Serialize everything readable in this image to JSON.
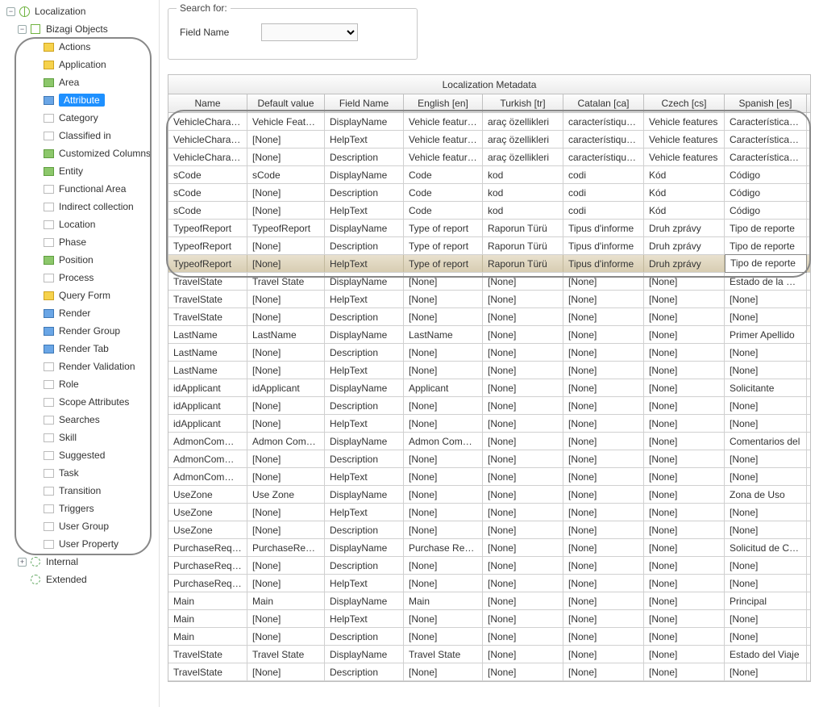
{
  "tree": {
    "root": "Localization",
    "bizagi": "Bizagi Objects",
    "internal": "Internal",
    "extended": "Extended",
    "items": [
      {
        "label": "Actions",
        "icon": "y"
      },
      {
        "label": "Application",
        "icon": "y"
      },
      {
        "label": "Area",
        "icon": "g"
      },
      {
        "label": "Attribute",
        "icon": "b",
        "selected": true
      },
      {
        "label": "Category",
        "icon": "o"
      },
      {
        "label": "Classified in",
        "icon": "o"
      },
      {
        "label": "Customized Columns",
        "icon": "g"
      },
      {
        "label": "Entity",
        "icon": "g"
      },
      {
        "label": "Functional Area",
        "icon": "o"
      },
      {
        "label": "Indirect collection",
        "icon": "o"
      },
      {
        "label": "Location",
        "icon": "o"
      },
      {
        "label": "Phase",
        "icon": "o"
      },
      {
        "label": "Position",
        "icon": "g"
      },
      {
        "label": "Process",
        "icon": "o"
      },
      {
        "label": "Query Form",
        "icon": "y"
      },
      {
        "label": "Render",
        "icon": "b"
      },
      {
        "label": "Render Group",
        "icon": "b"
      },
      {
        "label": "Render Tab",
        "icon": "b"
      },
      {
        "label": "Render Validation",
        "icon": "o"
      },
      {
        "label": "Role",
        "icon": "o"
      },
      {
        "label": "Scope Attributes",
        "icon": "o"
      },
      {
        "label": "Searches",
        "icon": "o"
      },
      {
        "label": "Skill",
        "icon": "o"
      },
      {
        "label": "Suggested",
        "icon": "o"
      },
      {
        "label": "Task",
        "icon": "o"
      },
      {
        "label": "Transition",
        "icon": "o"
      },
      {
        "label": "Triggers",
        "icon": "o"
      },
      {
        "label": "User Group",
        "icon": "o"
      },
      {
        "label": "User Property",
        "icon": "o"
      }
    ]
  },
  "search": {
    "legend": "Search for:",
    "label": "Field Name"
  },
  "grid": {
    "title": "Localization Metadata",
    "columns": [
      "Name",
      "Default value",
      "Field Name",
      "English [en]",
      "Turkish [tr]",
      "Catalan [ca]",
      "Czech [cs]",
      "Spanish [es]"
    ],
    "selected_row_index": 8,
    "editing_cell": {
      "row": 8,
      "col": 7
    },
    "rows": [
      [
        "VehicleCharacteri",
        "Vehicle Features",
        "DisplayName",
        "Vehicle features",
        "araç özellikleri",
        "característiques d",
        "Vehicle features",
        "Características del"
      ],
      [
        "VehicleCharacteri",
        "[None]",
        "HelpText",
        "Vehicle features",
        "araç özellikleri",
        "característiques d",
        "Vehicle features",
        "Características del"
      ],
      [
        "VehicleCharacteri",
        "[None]",
        "Description",
        "Vehicle features",
        "araç özellikleri",
        "característiques d",
        "Vehicle features",
        "Características del"
      ],
      [
        "sCode",
        "sCode",
        "DisplayName",
        "Code",
        "kod",
        "codi",
        "Kód",
        "Código"
      ],
      [
        "sCode",
        "[None]",
        "Description",
        "Code",
        "kod",
        "codi",
        "Kód",
        "Código"
      ],
      [
        "sCode",
        "[None]",
        "HelpText",
        "Code",
        "kod",
        "codi",
        "Kód",
        "Código"
      ],
      [
        "TypeofReport",
        "TypeofReport",
        "DisplayName",
        "Type of report",
        "Raporun Türü",
        "Tipus d'informe",
        "Druh zprávy",
        "Tipo de reporte"
      ],
      [
        "TypeofReport",
        "[None]",
        "Description",
        "Type of report",
        "Raporun Türü",
        "Tipus d'informe",
        "Druh zprávy",
        "Tipo de reporte"
      ],
      [
        "TypeofReport",
        "[None]",
        "HelpText",
        "Type of report",
        "Raporun Türü",
        "Tipus d'informe",
        "Druh zprávy",
        "Tipo de reporte"
      ],
      [
        "TravelState",
        "Travel State",
        "DisplayName",
        "[None]",
        "[None]",
        "[None]",
        "[None]",
        "Estado de la Solici"
      ],
      [
        "TravelState",
        "[None]",
        "HelpText",
        "[None]",
        "[None]",
        "[None]",
        "[None]",
        "[None]"
      ],
      [
        "TravelState",
        "[None]",
        "Description",
        "[None]",
        "[None]",
        "[None]",
        "[None]",
        "[None]"
      ],
      [
        "LastName",
        "LastName",
        "DisplayName",
        "LastName",
        "[None]",
        "[None]",
        "[None]",
        "Primer Apellido"
      ],
      [
        "LastName",
        "[None]",
        "Description",
        "[None]",
        "[None]",
        "[None]",
        "[None]",
        "[None]"
      ],
      [
        "LastName",
        "[None]",
        "HelpText",
        "[None]",
        "[None]",
        "[None]",
        "[None]",
        "[None]"
      ],
      [
        "idApplicant",
        "idApplicant",
        "DisplayName",
        "Applicant",
        "[None]",
        "[None]",
        "[None]",
        "Solicitante"
      ],
      [
        "idApplicant",
        "[None]",
        "Description",
        "[None]",
        "[None]",
        "[None]",
        "[None]",
        "[None]"
      ],
      [
        "idApplicant",
        "[None]",
        "HelpText",
        "[None]",
        "[None]",
        "[None]",
        "[None]",
        "[None]"
      ],
      [
        "AdmonComment",
        "Admon Comment",
        "DisplayName",
        "Admon Comment",
        "[None]",
        "[None]",
        "[None]",
        "Comentarios del"
      ],
      [
        "AdmonComment",
        "[None]",
        "Description",
        "[None]",
        "[None]",
        "[None]",
        "[None]",
        "[None]"
      ],
      [
        "AdmonComment",
        "[None]",
        "HelpText",
        "[None]",
        "[None]",
        "[None]",
        "[None]",
        "[None]"
      ],
      [
        "UseZone",
        "Use Zone",
        "DisplayName",
        "[None]",
        "[None]",
        "[None]",
        "[None]",
        "Zona de Uso"
      ],
      [
        "UseZone",
        "[None]",
        "HelpText",
        "[None]",
        "[None]",
        "[None]",
        "[None]",
        "[None]"
      ],
      [
        "UseZone",
        "[None]",
        "Description",
        "[None]",
        "[None]",
        "[None]",
        "[None]",
        "[None]"
      ],
      [
        "PurchaseRequest",
        "PurchaseRequest",
        "DisplayName",
        "Purchase Request",
        "[None]",
        "[None]",
        "[None]",
        "Solicitud de Com"
      ],
      [
        "PurchaseRequest",
        "[None]",
        "Description",
        "[None]",
        "[None]",
        "[None]",
        "[None]",
        "[None]"
      ],
      [
        "PurchaseRequest",
        "[None]",
        "HelpText",
        "[None]",
        "[None]",
        "[None]",
        "[None]",
        "[None]"
      ],
      [
        "Main",
        "Main",
        "DisplayName",
        "Main",
        "[None]",
        "[None]",
        "[None]",
        "Principal"
      ],
      [
        "Main",
        "[None]",
        "HelpText",
        "[None]",
        "[None]",
        "[None]",
        "[None]",
        "[None]"
      ],
      [
        "Main",
        "[None]",
        "Description",
        "[None]",
        "[None]",
        "[None]",
        "[None]",
        "[None]"
      ],
      [
        "TravelState",
        "Travel State",
        "DisplayName",
        "Travel State",
        "[None]",
        "[None]",
        "[None]",
        "Estado del Viaje"
      ],
      [
        "TravelState",
        "[None]",
        "Description",
        "[None]",
        "[None]",
        "[None]",
        "[None]",
        "[None]"
      ]
    ]
  }
}
